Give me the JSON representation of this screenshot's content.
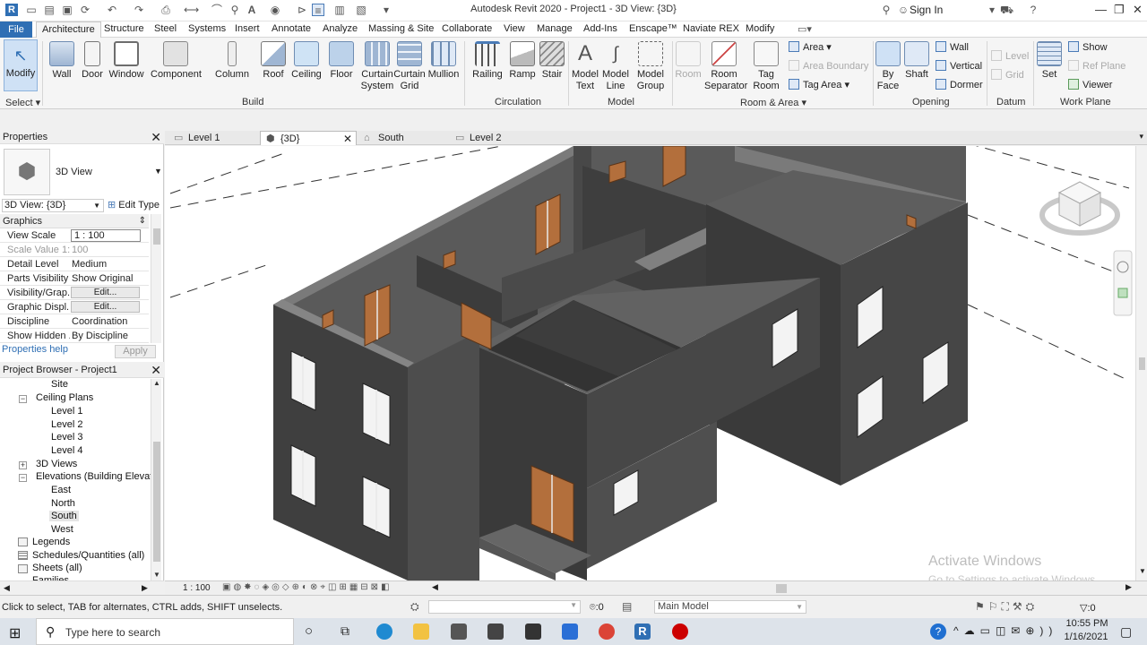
{
  "window": {
    "title": "Autodesk Revit 2020 - Project1 - 3D View: {3D}",
    "signin": "Sign In"
  },
  "tabs": [
    "File",
    "Architecture",
    "Structure",
    "Steel",
    "Systems",
    "Insert",
    "Annotate",
    "Analyze",
    "Massing & Site",
    "Collaborate",
    "View",
    "Manage",
    "Add-Ins",
    "Enscape™",
    "Naviate REX",
    "Modify"
  ],
  "ribbon": {
    "select": {
      "modify": "Modify",
      "label": "Select"
    },
    "build": {
      "wall": "Wall",
      "door": "Door",
      "window": "Window",
      "component": "Component",
      "column": "Column",
      "roof": "Roof",
      "ceiling": "Ceiling",
      "floor": "Floor",
      "curtain_system": "Curtain\nSystem",
      "curtain_grid": "Curtain\nGrid",
      "mullion": "Mullion",
      "label": "Build"
    },
    "circulation": {
      "railing": "Railing",
      "ramp": "Ramp",
      "stair": "Stair",
      "label": "Circulation"
    },
    "model": {
      "model_text": "Model\nText",
      "model_line": "Model\nLine",
      "model_group": "Model\nGroup",
      "label": "Model"
    },
    "room_area": {
      "room": "Room",
      "room_separator": "Room\nSeparator",
      "tag_room": "Tag\nRoom",
      "area": "Area",
      "area_boundary": "Area  Boundary",
      "tag_area": "Tag  Area",
      "label": "Room & Area"
    },
    "opening": {
      "by_face": "By\nFace",
      "shaft": "Shaft",
      "wall": "Wall",
      "vertical": "Vertical",
      "dormer": "Dormer",
      "label": "Opening"
    },
    "datum": {
      "level": "Level",
      "grid": "Grid",
      "label": "Datum"
    },
    "work_plane": {
      "set": "Set",
      "show": "Show",
      "ref_plane": "Ref  Plane",
      "viewer": "Viewer",
      "label": "Work Plane"
    }
  },
  "properties": {
    "title": "Properties",
    "type_name": "3D View",
    "selector": "3D View: {3D}",
    "edit_type": "Edit Type",
    "section": "Graphics",
    "rows": [
      {
        "k": "View Scale",
        "v": "1 : 100"
      },
      {
        "k": "Scale Value    1:",
        "v": "100"
      },
      {
        "k": "Detail Level",
        "v": "Medium"
      },
      {
        "k": "Parts Visibility",
        "v": "Show Original"
      },
      {
        "k": "Visibility/Grap...",
        "v": "Edit..."
      },
      {
        "k": "Graphic Displ...",
        "v": "Edit..."
      },
      {
        "k": "Discipline",
        "v": "Coordination"
      },
      {
        "k": "Show Hidden ...",
        "v": "By Discipline"
      }
    ],
    "help": "Properties help",
    "apply": "Apply"
  },
  "browser": {
    "title": "Project Browser - Project1",
    "items": [
      "Site",
      "Ceiling Plans",
      "Level 1",
      "Level 2",
      "Level 3",
      "Level 4",
      "3D Views",
      "Elevations (Building Elevatio",
      "East",
      "North",
      "South",
      "West",
      "Legends",
      "Schedules/Quantities (all)",
      "Sheets (all)",
      "Families"
    ]
  },
  "view_tabs": [
    "Level 1",
    "{3D}",
    "South",
    "Level 2"
  ],
  "viewbar": {
    "scale": "1 : 100"
  },
  "status": {
    "hint": "Click to select, TAB for alternates, CTRL adds, SHIFT unselects.",
    "model": "Main Model",
    "filter": ":0",
    "sel": ":0"
  },
  "watermark": {
    "line1": "Activate Windows",
    "line2": "Go to Settings to activate Windows."
  },
  "taskbar": {
    "search": "Type here to search",
    "time": "10:55 PM",
    "date": "1/16/2021"
  }
}
